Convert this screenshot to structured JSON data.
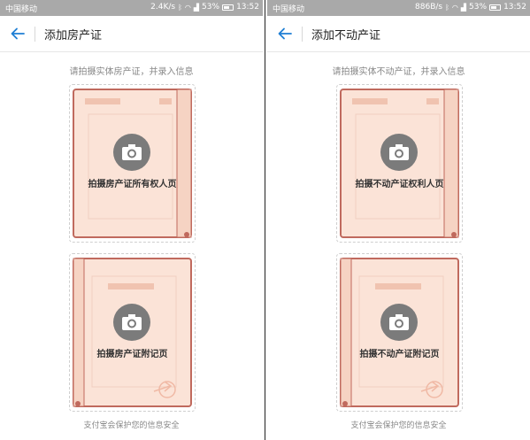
{
  "screens": [
    {
      "status": {
        "carrier": "中国移动",
        "speed": "2.4K/s",
        "battery": "53%",
        "time": "13:52"
      },
      "nav": {
        "title": "添加房产证"
      },
      "instruction": "请拍摄实体房产证，并录入信息",
      "cards": [
        {
          "label": "拍摄房产证所有权人页"
        },
        {
          "label": "拍摄房产证附记页"
        }
      ],
      "footer": "支付宝会保护您的信息安全"
    },
    {
      "status": {
        "carrier": "中国移动",
        "speed": "886B/s",
        "battery": "53%",
        "time": "13:52"
      },
      "nav": {
        "title": "添加不动产证"
      },
      "instruction": "请拍摄实体不动产证，并录入信息",
      "cards": [
        {
          "label": "拍摄不动产证权利人页"
        },
        {
          "label": "拍摄不动产证附记页"
        }
      ],
      "footer": "支付宝会保护您的信息安全"
    }
  ],
  "colors": {
    "accent": "#1f7fd4",
    "doc_fill": "#fbe3d7",
    "doc_border": "#c06a5e",
    "statusbar": "#a9a9a9",
    "camera_circle": "#7b7b7b"
  },
  "icons": [
    "back-arrow-icon",
    "camera-icon",
    "battery-icon",
    "wifi-icon",
    "signal-icon",
    "bluetooth-icon"
  ]
}
